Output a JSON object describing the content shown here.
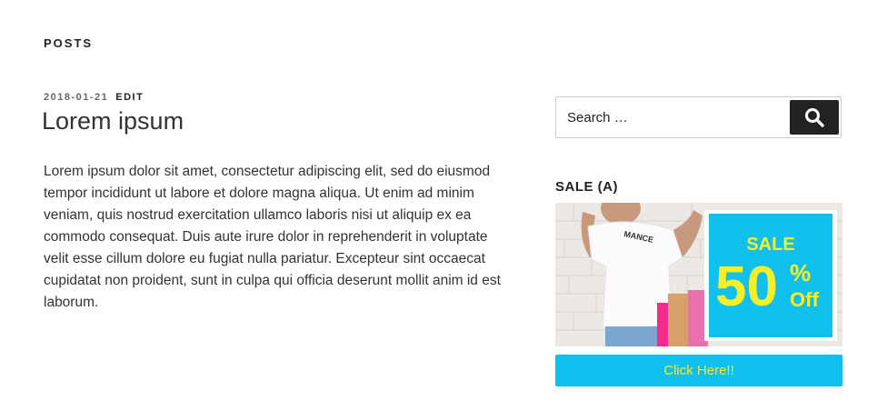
{
  "section": {
    "title": "POSTS"
  },
  "post": {
    "date": "2018-01-21",
    "edit_label": "EDIT",
    "title": "Lorem ipsum",
    "body": "Lorem ipsum dolor sit amet, consectetur adipiscing elit, sed do eiusmod tempor incididunt ut labore et dolore magna aliqua. Ut enim ad minim veniam, quis nostrud exercitation ullamco laboris nisi ut aliquip ex ea commodo consequat. Duis aute irure dolor in reprehenderit in voluptate velit esse cillum dolore eu fugiat nulla pariatur. Excepteur sint occaecat cupidatat non proident, sunt in culpa qui officia deserunt mollit anim id est laborum."
  },
  "sidebar": {
    "search": {
      "placeholder": "Search …",
      "button_icon": "search-icon"
    },
    "ad_widget": {
      "title": "SALE (A)",
      "banner": {
        "sale_text": "SALE",
        "percent_text": "50",
        "percent_sign": "%",
        "off_text": "Off",
        "shirt_text": "MANCE"
      },
      "link_label": "Click Here!!"
    }
  },
  "colors": {
    "accent_button": "#0fbfef",
    "button_text": "#ffe81a",
    "banner_box": "#12c0ee",
    "search_button": "#222222"
  }
}
